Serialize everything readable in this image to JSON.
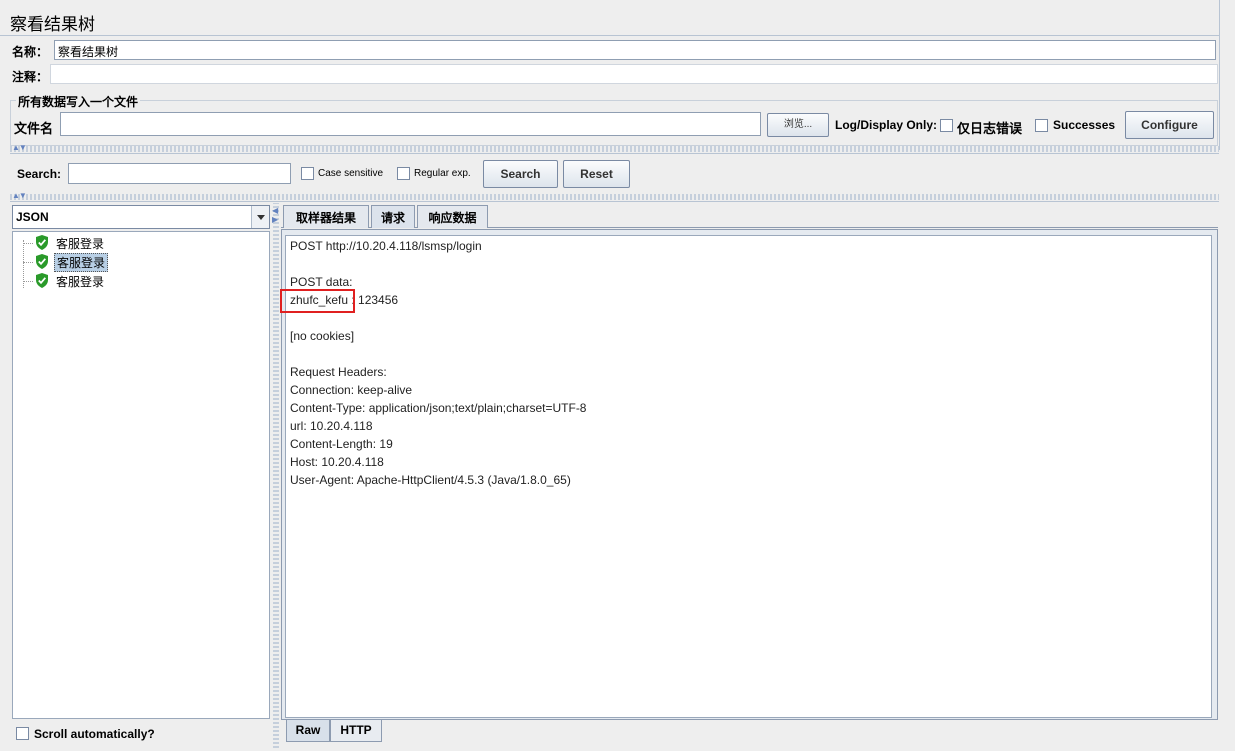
{
  "window": {
    "title": "察看结果树"
  },
  "form": {
    "name_label": "名称：",
    "name_value": "察看结果树",
    "comment_label": "注释：",
    "comment_value": ""
  },
  "file_section": {
    "legend": "所有数据写入一个文件",
    "filename_label": "文件名",
    "filename_value": "",
    "browse_label": "浏览...",
    "log_display_label": "Log/Display Only:",
    "errors_only_label": "仅日志错误",
    "successes_label": "Successes",
    "configure_label": "Configure"
  },
  "search": {
    "label": "Search:",
    "value": "",
    "case_sensitive_label": "Case sensitive",
    "regex_label": "Regular exp.",
    "search_button": "Search",
    "reset_button": "Reset"
  },
  "renderer": {
    "selected": "JSON"
  },
  "tree": {
    "items": [
      {
        "label": "客服登录",
        "status": "success",
        "selected": false
      },
      {
        "label": "客服登录",
        "status": "success",
        "selected": true
      },
      {
        "label": "客服登录",
        "status": "success",
        "selected": false
      }
    ]
  },
  "scroll_auto_label": "Scroll automatically?",
  "result_tabs": {
    "tabs": [
      "取样器结果",
      "请求",
      "响应数据"
    ],
    "active": "请求"
  },
  "request": {
    "lines": [
      "POST http://10.20.4.118/lsmsp/login",
      "",
      "POST data:",
      "zhufc_kefu : 123456",
      "",
      "[no cookies]",
      "",
      "Request Headers:",
      "Connection: keep-alive",
      "Content-Type: application/json;text/plain;charset=UTF-8",
      "url: 10.20.4.118",
      "Content-Length: 19",
      "Host: 10.20.4.118",
      "User-Agent: Apache-HttpClient/4.5.3 (Java/1.8.0_65)"
    ],
    "highlight_color": "#e02020"
  },
  "bottom_tabs": {
    "tabs": [
      "Raw",
      "HTTP"
    ],
    "active": "Raw"
  },
  "colors": {
    "success_green": "#2a9a2a",
    "selection_bg": "#b8cfe5",
    "accent_blue": "#6382bf"
  }
}
